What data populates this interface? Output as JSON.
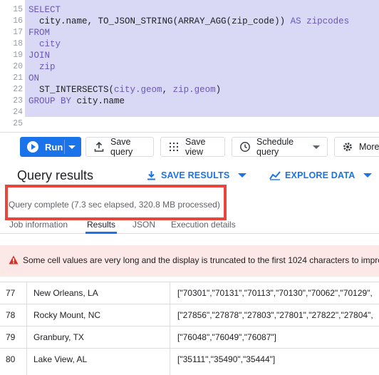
{
  "editor": {
    "lines": [
      {
        "num": "15",
        "tokens": [
          {
            "t": "SELECT",
            "c": "kw"
          }
        ]
      },
      {
        "num": "16",
        "tokens": [
          {
            "t": "  city.name, ",
            "c": "plain"
          },
          {
            "t": "TO_JSON_STRING",
            "c": "fn"
          },
          {
            "t": "(",
            "c": "plain"
          },
          {
            "t": "ARRAY_AGG",
            "c": "fn"
          },
          {
            "t": "(zip_code)) ",
            "c": "plain"
          },
          {
            "t": "AS",
            "c": "kw"
          },
          {
            "t": " zipcodes",
            "c": "id"
          }
        ]
      },
      {
        "num": "17",
        "tokens": [
          {
            "t": "FROM",
            "c": "kw"
          }
        ]
      },
      {
        "num": "18",
        "tokens": [
          {
            "t": "  city",
            "c": "id"
          }
        ]
      },
      {
        "num": "19",
        "tokens": [
          {
            "t": "JOIN",
            "c": "kw"
          }
        ]
      },
      {
        "num": "20",
        "tokens": [
          {
            "t": "  zip",
            "c": "id"
          }
        ]
      },
      {
        "num": "21",
        "tokens": [
          {
            "t": "ON",
            "c": "kw"
          }
        ]
      },
      {
        "num": "22",
        "tokens": [
          {
            "t": "  ST_INTERSECTS",
            "c": "fn"
          },
          {
            "t": "(",
            "c": "plain"
          },
          {
            "t": "city.geom",
            "c": "id"
          },
          {
            "t": ", ",
            "c": "plain"
          },
          {
            "t": "zip.geom",
            "c": "id"
          },
          {
            "t": ")",
            "c": "plain"
          }
        ]
      },
      {
        "num": "23",
        "tokens": [
          {
            "t": "GROUP BY ",
            "c": "kw"
          },
          {
            "t": "city.name",
            "c": "plain"
          }
        ]
      },
      {
        "num": "24",
        "tokens": []
      },
      {
        "num": "25",
        "tokens": []
      }
    ]
  },
  "toolbar": {
    "run_label": "Run",
    "save_query_label": "Save query",
    "save_view_label": "Save view",
    "schedule_query_label": "Schedule query",
    "more_label": "More"
  },
  "results": {
    "title": "Query results",
    "save_results_label": "SAVE RESULTS",
    "explore_data_label": "EXPLORE DATA",
    "status": "Query complete (7.3 sec elapsed, 320.8 MB processed)",
    "tabs": [
      "Job information",
      "Results",
      "JSON",
      "Execution details"
    ],
    "warning": "Some cell values are very long and the display is truncated to the first 1024 characters to impro"
  },
  "table": {
    "rows": [
      {
        "num": "77",
        "city": "New Orleans, LA",
        "zipcodes": "[\"70301\",\"70131\",\"70113\",\"70130\",\"70062\",\"70129\","
      },
      {
        "num": "78",
        "city": "Rocky Mount, NC",
        "zipcodes": "[\"27856\",\"27878\",\"27803\",\"27801\",\"27822\",\"27804\","
      },
      {
        "num": "79",
        "city": "Granbury, TX",
        "zipcodes": "[\"76048\",\"76049\",\"76087\"]"
      },
      {
        "num": "80",
        "city": "Lake View, AL",
        "zipcodes": "[\"35111\",\"35490\",\"35444\"]"
      }
    ]
  },
  "colors": {
    "accent": "#1a73e8",
    "selection": "#d9d8f5",
    "highlight_box": "#e8453c",
    "warning_bg": "#fce8e6",
    "warning_icon": "#d93025"
  }
}
